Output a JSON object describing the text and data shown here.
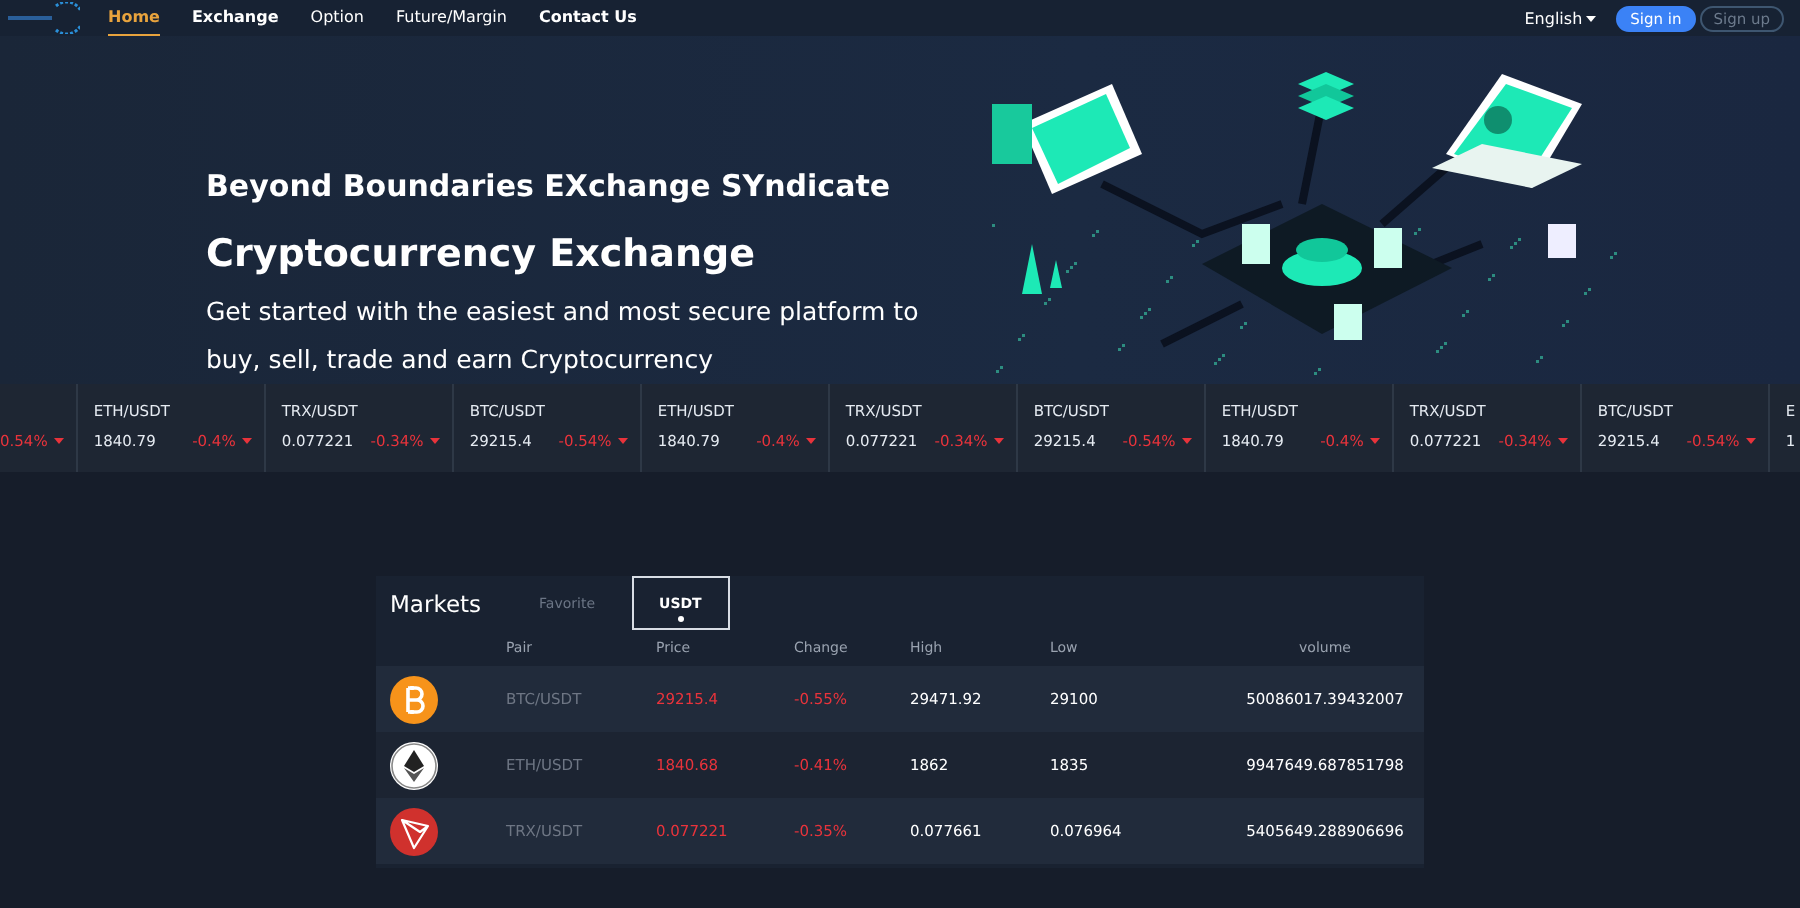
{
  "nav": {
    "items": [
      {
        "label": "Home",
        "selected": true,
        "emphasis": false
      },
      {
        "label": "Exchange",
        "selected": false,
        "emphasis": true
      },
      {
        "label": "Option",
        "selected": false,
        "emphasis": false
      },
      {
        "label": "Future/Margin",
        "selected": false,
        "emphasis": false
      },
      {
        "label": "Contact Us",
        "selected": false,
        "emphasis": true
      }
    ],
    "language": "English",
    "sign_in": "Sign in",
    "sign_up": "Sign up"
  },
  "hero": {
    "tagline": "Beyond Boundaries EXchange SYndicate",
    "title": "Cryptocurrency Exchange",
    "description": "Get started with the easiest and most secure platform to buy, sell, trade and earn Cryptocurrency"
  },
  "ticker": [
    {
      "change": "0.54%",
      "falling": true
    },
    {
      "pair": "ETH/USDT",
      "price": "1840.79",
      "change": "-0.4%",
      "falling": true
    },
    {
      "pair": "TRX/USDT",
      "price": "0.077221",
      "change": "-0.34%",
      "falling": true
    },
    {
      "pair": "BTC/USDT",
      "price": "29215.4",
      "change": "-0.54%",
      "falling": true
    },
    {
      "pair": "ETH/USDT",
      "price": "1840.79",
      "change": "-0.4%",
      "falling": true
    },
    {
      "pair": "TRX/USDT",
      "price": "0.077221",
      "change": "-0.34%",
      "falling": true
    },
    {
      "pair": "BTC/USDT",
      "price": "29215.4",
      "change": "-0.54%",
      "falling": true
    },
    {
      "pair": "ETH/USDT",
      "price": "1840.79",
      "change": "-0.4%",
      "falling": true
    },
    {
      "pair": "TRX/USDT",
      "price": "0.077221",
      "change": "-0.34%",
      "falling": true
    },
    {
      "pair": "BTC/USDT",
      "price": "29215.4",
      "change": "-0.54%",
      "falling": true
    },
    {
      "pair": "E",
      "price": "1"
    }
  ],
  "markets": {
    "title": "Markets",
    "tabs": [
      {
        "label": "Favorite",
        "selected": false
      },
      {
        "label": "USDT",
        "selected": true
      }
    ],
    "columns": [
      "Pair",
      "Price",
      "Change",
      "High",
      "Low",
      "volume"
    ],
    "rows": [
      {
        "kind": "btc",
        "pair": "BTC/USDT",
        "price": "29215.4",
        "change": "-0.55%",
        "high": "29471.92",
        "low": "29100",
        "volume": "50086017.39432007",
        "falling": true
      },
      {
        "kind": "eth",
        "pair": "ETH/USDT",
        "price": "1840.68",
        "change": "-0.41%",
        "high": "1862",
        "low": "1835",
        "volume": "9947649.687851798",
        "falling": true
      },
      {
        "kind": "trx",
        "pair": "TRX/USDT",
        "price": "0.077221",
        "change": "-0.35%",
        "high": "0.077661",
        "low": "0.076964",
        "volume": "5405649.288906696",
        "falling": true
      }
    ]
  }
}
